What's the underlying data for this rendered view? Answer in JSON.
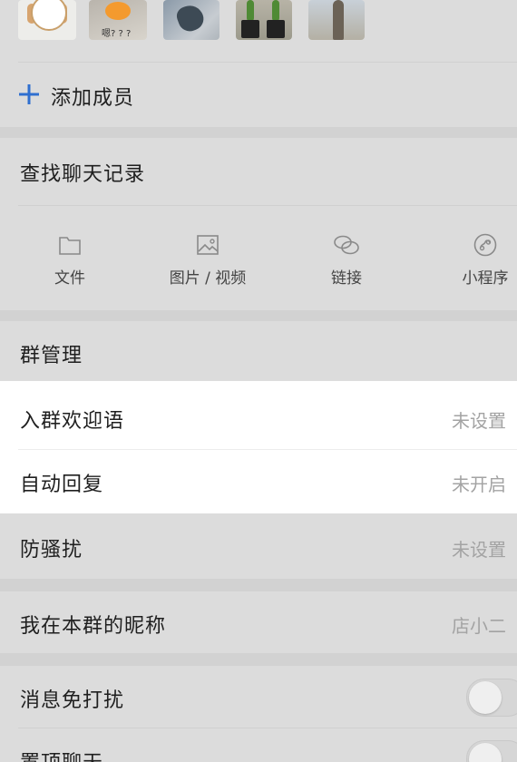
{
  "avatar_strip": {
    "members": [
      {
        "name": "member-avatar-1"
      },
      {
        "name": "member-avatar-2",
        "caption": "嗯? ? ?"
      },
      {
        "name": "member-avatar-3"
      },
      {
        "name": "member-avatar-4"
      },
      {
        "name": "member-avatar-5"
      }
    ]
  },
  "add_member": {
    "icon": "plus-icon",
    "label": "添加成员"
  },
  "search_history": {
    "label": "查找聊天记录"
  },
  "media_filters": [
    {
      "icon": "folder-icon",
      "label": "文件"
    },
    {
      "icon": "image-icon",
      "label": "图片 / 视频"
    },
    {
      "icon": "link-icon",
      "label": "链接"
    },
    {
      "icon": "mini-program-icon",
      "label": "小程序"
    }
  ],
  "group_management": {
    "label": "群管理"
  },
  "settings": {
    "welcome_message": {
      "label": "入群欢迎语",
      "value": "未设置"
    },
    "auto_reply": {
      "label": "自动回复",
      "value": "未开启"
    },
    "anti_harassment": {
      "label": "防骚扰",
      "value": "未设置"
    },
    "my_nickname": {
      "label": "我在本群的昵称",
      "value": "店小二"
    },
    "mute_notifications": {
      "label": "消息免打扰",
      "enabled": false
    },
    "pin_chat": {
      "label": "置顶聊天",
      "enabled": false
    }
  },
  "colors": {
    "page_bg": "#dcdcdc",
    "highlight_bg": "#ffffff",
    "accent": "#2f6fd0",
    "muted_text": "#a3a3a3"
  }
}
